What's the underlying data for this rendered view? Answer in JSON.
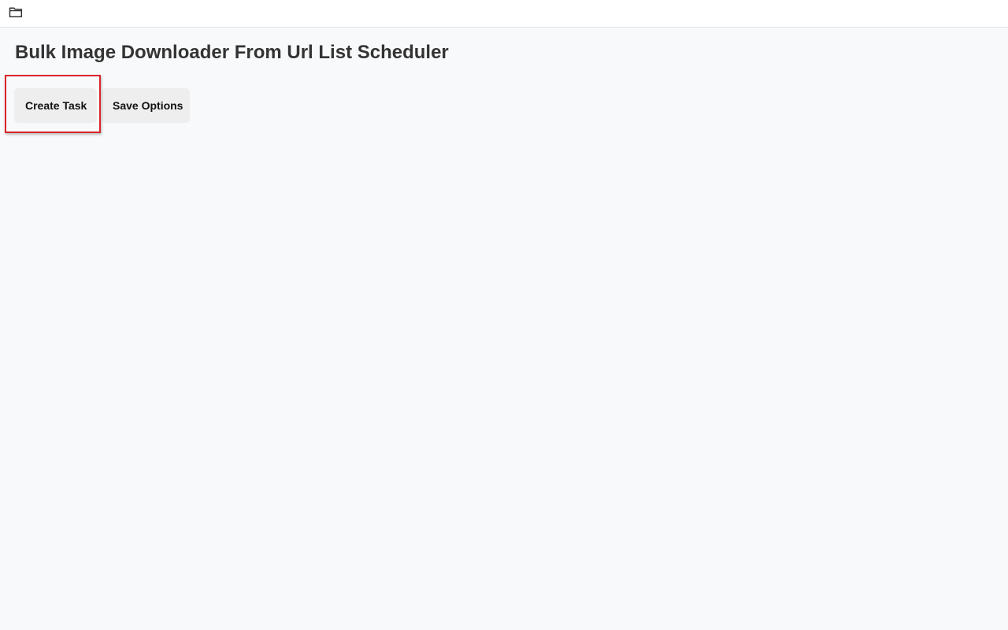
{
  "toolbar": {
    "folder_icon": "folder-icon"
  },
  "page": {
    "title": "Bulk Image Downloader From Url List Scheduler"
  },
  "actions": {
    "create_task_label": "Create Task",
    "save_options_label": "Save Options"
  },
  "colors": {
    "background": "#f8f9fa",
    "topbar": "#ffffff",
    "button_bg": "#eeeeee",
    "highlight": "#d9242b",
    "title_text": "#333333"
  }
}
